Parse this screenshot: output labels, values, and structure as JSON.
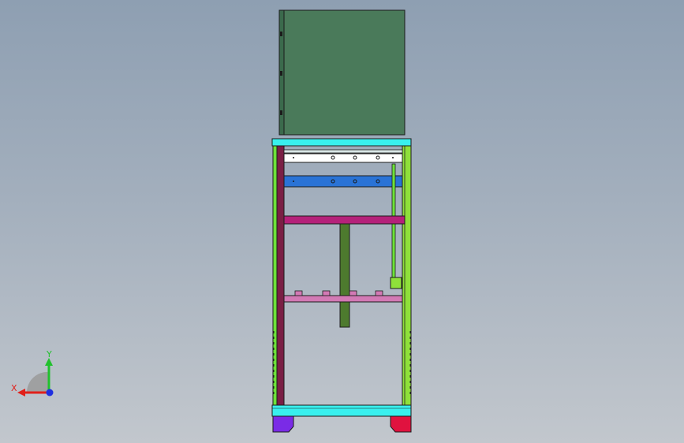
{
  "viewport": {
    "background_top": "#8e9fb2",
    "background_bottom": "#c2c7cd"
  },
  "triad": {
    "x_label": "X",
    "y_label": "Y",
    "x_color": "#e0201a",
    "y_color": "#21c12d",
    "z_color": "#1f2fe0"
  },
  "model": {
    "colors": {
      "electrical_box": "#4a7a5a",
      "top_plate": "#39f0ee",
      "upright_left_outer": "#6ee23a",
      "upright_left_inner": "#7a1f45",
      "upright_right": "#8fe03a",
      "white_rail": "#ffffff",
      "blue_rail": "#2a73d6",
      "magenta_beam": "#b5217a",
      "pink_beam": "#d37ab5",
      "center_post": "#4d7a2e",
      "side_rod": "#6ee23a",
      "base_plate": "#39f0ee",
      "foot_left": "#7a2be6",
      "foot_right": "#e0123f",
      "edge": "#1b1b1b"
    }
  }
}
